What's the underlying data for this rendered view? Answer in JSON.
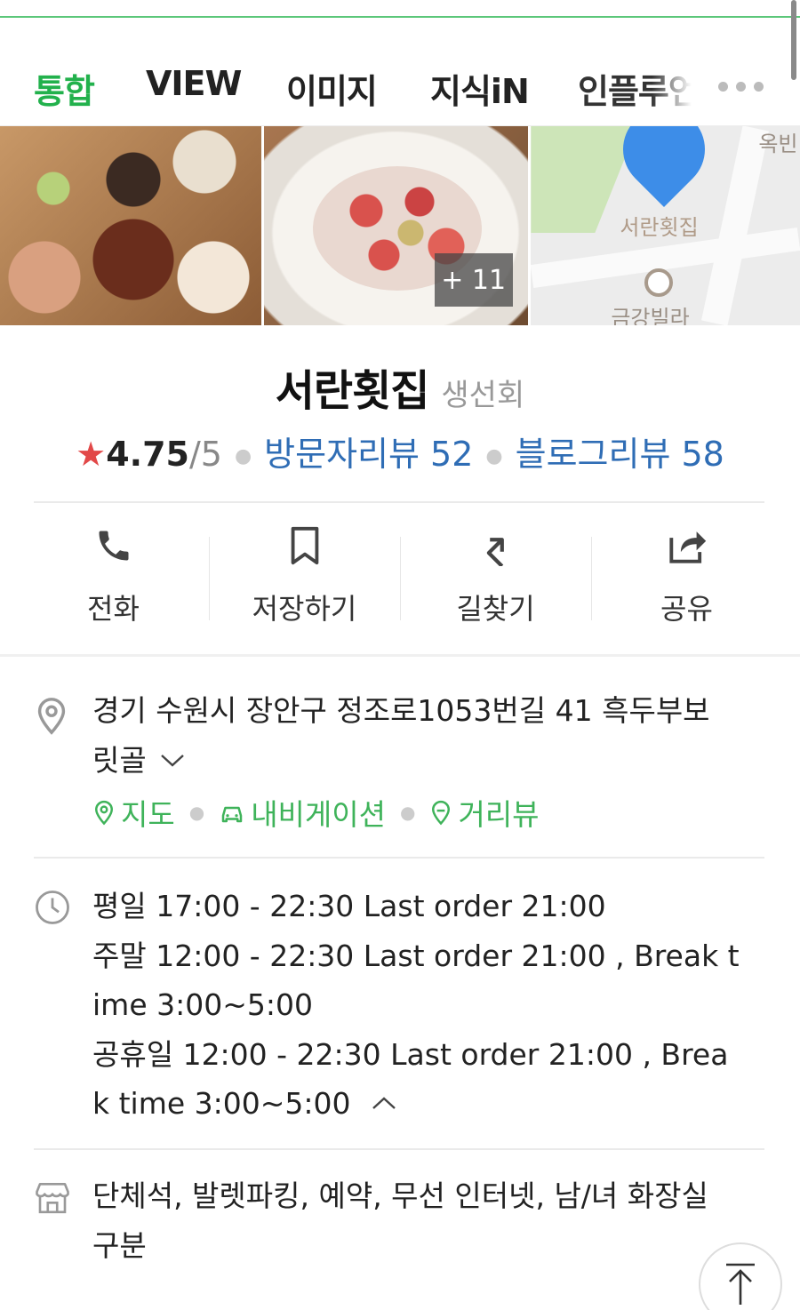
{
  "tabs": [
    {
      "label": "통합",
      "active": true
    },
    {
      "label": "VIEW",
      "active": false
    },
    {
      "label": "이미지",
      "active": false
    },
    {
      "label": "지식iN",
      "active": false
    },
    {
      "label": "인플루언서",
      "active": false
    }
  ],
  "tab_more_icon": "more-dots-icon",
  "photos": {
    "more_count": "+ 11",
    "map_place_label": "서란횟집",
    "map_poi_label": "금강빌라",
    "map_corner_label": "옥빈"
  },
  "place": {
    "name": "서란횟집",
    "category": "생선회",
    "rating": "4.75",
    "rating_max": "/5",
    "visitor_review_label": "방문자리뷰 52",
    "blog_review_label": "블로그리뷰 58"
  },
  "actions": [
    {
      "label": "전화",
      "icon": "phone-icon"
    },
    {
      "label": "저장하기",
      "icon": "bookmark-icon"
    },
    {
      "label": "길찾기",
      "icon": "directions-icon"
    },
    {
      "label": "공유",
      "icon": "share-icon"
    }
  ],
  "address": {
    "line1": "경기 수원시 장안구 정조로1053번길 41 흑두부보",
    "line2": "릿골",
    "links": [
      {
        "label": "지도",
        "icon": "map-pin-icon"
      },
      {
        "label": "내비게이션",
        "icon": "car-icon"
      },
      {
        "label": "거리뷰",
        "icon": "street-view-icon"
      }
    ]
  },
  "hours": {
    "lines": [
      "평일 17:00 - 22:30 Last order 21:00",
      "주말 12:00 - 22:30 Last order 21:00 , Break t",
      "ime 3:00~5:00",
      "공휴일 12:00 - 22:30 Last order 21:00 , Brea",
      "k time 3:00~5:00"
    ]
  },
  "amenities": {
    "line1": "단체석, 발렛파킹, 예약, 무선 인터넷, 남/녀 화장실",
    "line2": "구분"
  },
  "colors": {
    "active_tab": "#22b14c",
    "link_blue": "#2f6db5",
    "link_green": "#3fb35a",
    "star_red": "#e24848"
  }
}
